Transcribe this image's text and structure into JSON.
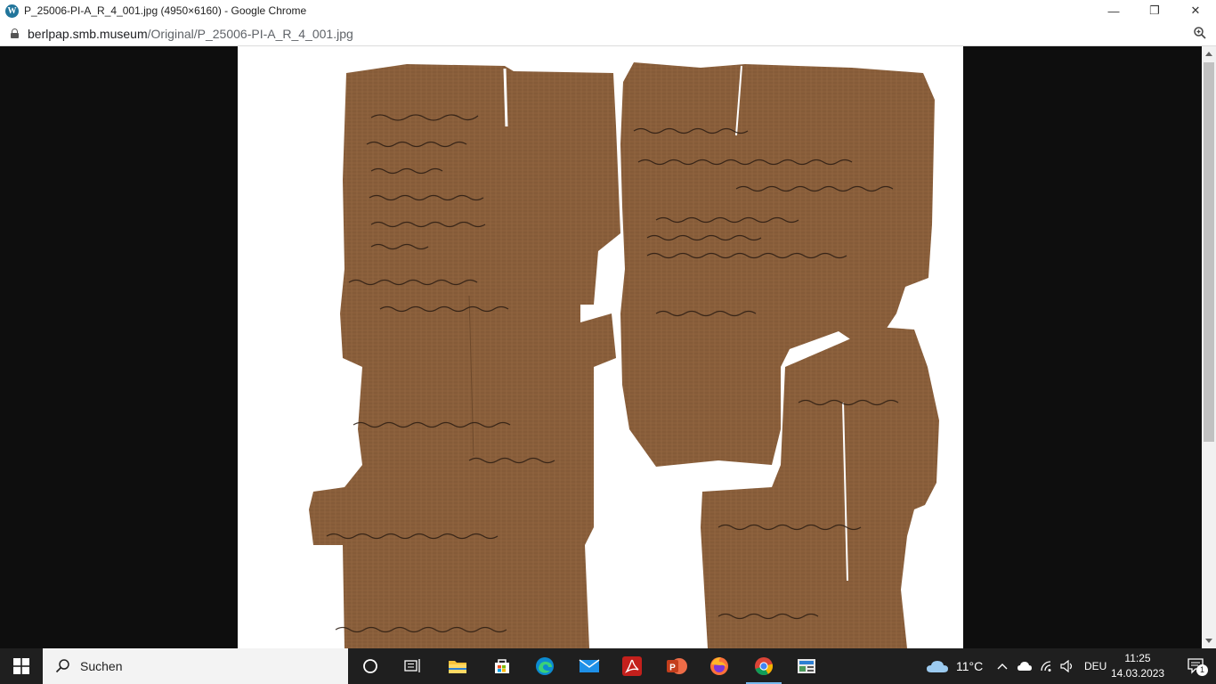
{
  "window": {
    "title": "P_25006-PI-A_R_4_001.jpg (4950×6160) - Google Chrome",
    "minimize_glyph": "—",
    "maximize_glyph": "❐",
    "close_glyph": "✕"
  },
  "address": {
    "host": "berlpap.smb.museum",
    "path": "/Original/P_25006-PI-A_R_4_001.jpg"
  },
  "image": {
    "subject": "papyrus fragment with Greek handwriting"
  },
  "taskbar": {
    "search_label": "Suchen",
    "weather": "11°C",
    "language": "DEU",
    "time": "11:25",
    "date": "14.03.2023",
    "notification_count": "1",
    "apps": [
      "task-view",
      "file-explorer",
      "microsoft-store",
      "edge",
      "mail",
      "acrobat",
      "powerpoint",
      "firefox",
      "chrome",
      "photos"
    ]
  },
  "colors": {
    "papyrus": "#8a5f3b",
    "papyrus_dark": "#6e4a2c",
    "ink": "#2a1c12",
    "taskbar": "#1f1f1f",
    "viewport_bg": "#0e0e0e"
  }
}
